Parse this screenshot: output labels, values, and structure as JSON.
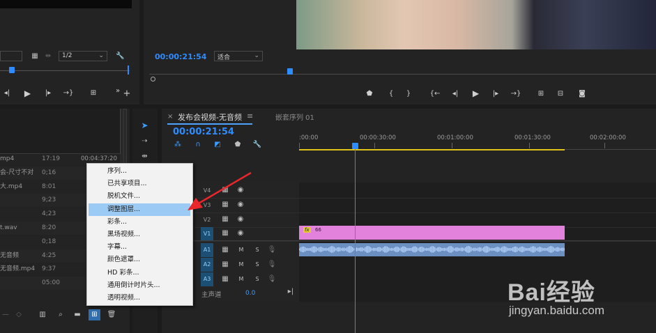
{
  "program_monitor": {
    "timecode": "00:00:21:54",
    "fit_label": "适合"
  },
  "source_monitor": {
    "resolution": "1/2"
  },
  "timeline": {
    "tab_active": "发布会视频-无音频",
    "tab_menu_glyph": "≡",
    "tab_other": "嵌套序列 01",
    "close_glyph": "×",
    "timecode": "00:00:21:54",
    "ruler": [
      ":00:00",
      "00:00:30:00",
      "00:01:00:00",
      "00:01:30:00",
      "00:02:00:00"
    ],
    "tracks_video": [
      {
        "label": "V4",
        "selected": false
      },
      {
        "label": "V3",
        "selected": false
      },
      {
        "label": "V2",
        "selected": false
      },
      {
        "label": "V1",
        "selected": true
      }
    ],
    "tracks_audio": [
      {
        "label": "A1",
        "m": "M",
        "s": "S"
      },
      {
        "label": "A2",
        "m": "M",
        "s": "S"
      },
      {
        "label": "A3",
        "m": "M",
        "s": "S"
      }
    ],
    "master_label": "主声道",
    "master_value": "0.0",
    "clip_fx": "fx",
    "clip_number": "66"
  },
  "project": {
    "header_time": "00:04:37:20",
    "files": [
      {
        "name": "mp4",
        "duration": "17:19"
      },
      {
        "name": "会-尺寸不对",
        "duration": "0;16"
      },
      {
        "name": "大.mp4",
        "duration": "8:01"
      },
      {
        "name": "",
        "duration": "9;23"
      },
      {
        "name": "",
        "duration": "4;23"
      },
      {
        "name": "t.wav",
        "duration": "8:20"
      },
      {
        "name": "",
        "duration": "0;18"
      },
      {
        "name": "无音频",
        "duration": "4:25"
      },
      {
        "name": "无音频.mp4",
        "duration": "9:37"
      },
      {
        "name": "",
        "duration": "05:00"
      }
    ]
  },
  "context_menu": {
    "items": [
      {
        "label": "序列...",
        "highlighted": false
      },
      {
        "label": "已共享项目...",
        "highlighted": false
      },
      {
        "label": "脱机文件...",
        "highlighted": false
      },
      {
        "label": "调整图层...",
        "highlighted": true
      },
      {
        "label": "彩条...",
        "highlighted": false
      },
      {
        "label": "黑场视频...",
        "highlighted": false
      },
      {
        "label": "字幕...",
        "highlighted": false
      },
      {
        "label": "颜色遮罩...",
        "highlighted": false
      },
      {
        "label": "HD 彩条...",
        "highlighted": false
      },
      {
        "label": "通用倒计时片头...",
        "highlighted": false
      },
      {
        "label": "透明视频...",
        "highlighted": false
      }
    ]
  },
  "watermark": {
    "brand": "Bai经验",
    "url": "jingyan.baidu.com"
  },
  "colors": {
    "accent": "#2e8cff",
    "clip_video": "#e382dd",
    "clip_audio": "#6b8fc1",
    "menu_highlight": "#9bcaf4",
    "arrow": "#e8262c"
  }
}
